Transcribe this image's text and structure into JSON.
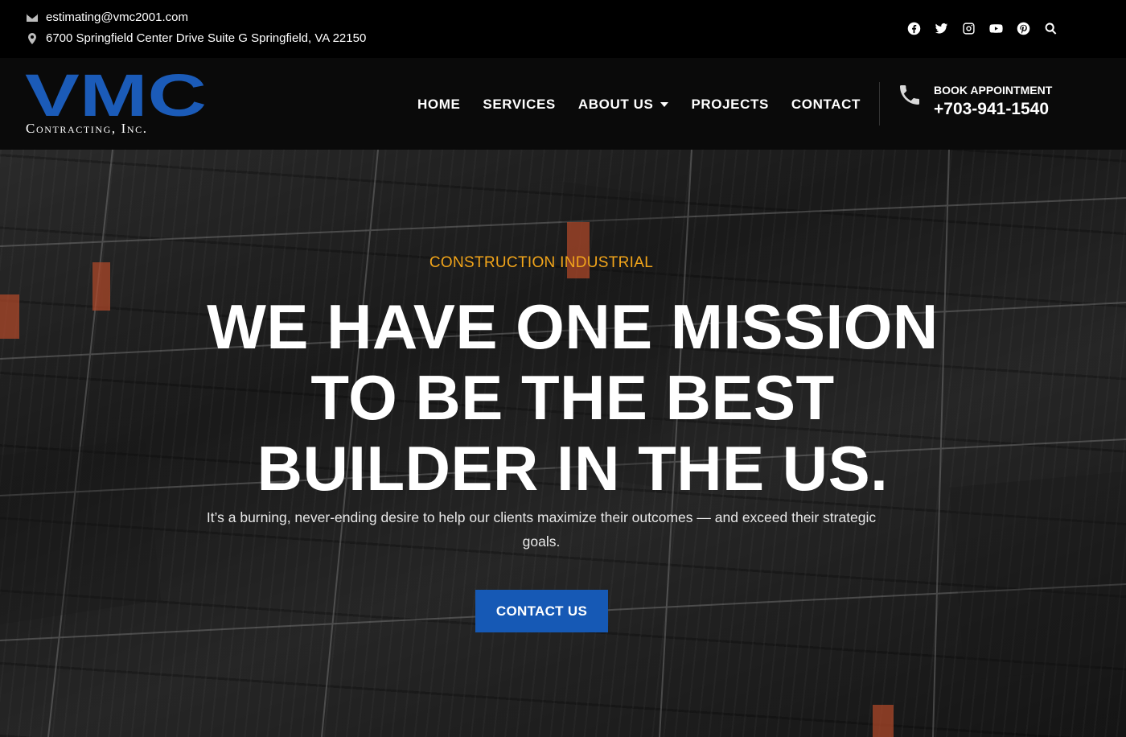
{
  "topbar": {
    "email": "estimating@vmc2001.com",
    "address": "6700 Springfield Center Drive Suite G Springfield, VA 22150",
    "email_icon": "envelope-icon",
    "address_icon": "map-pin-icon",
    "social_icons": [
      "facebook-icon",
      "twitter-icon",
      "instagram-icon",
      "youtube-icon",
      "pinterest-icon",
      "search-icon"
    ]
  },
  "logo": {
    "mark": "VMC",
    "subtitle": "Contracting, Inc.",
    "brand_color": "#1b5bb8"
  },
  "nav": {
    "items": [
      {
        "label": "HOME"
      },
      {
        "label": "SERVICES"
      },
      {
        "label": "ABOUT US",
        "has_dropdown": true
      },
      {
        "label": "PROJECTS"
      },
      {
        "label": "CONTACT"
      }
    ]
  },
  "appointment": {
    "label": "BOOK APPOINTMENT",
    "phone": "+703-941-1540",
    "icon": "phone-icon"
  },
  "hero": {
    "eyebrow": "CONSTRUCTION INDUSTRIAL",
    "headline_lines": [
      "WE HAVE ONE MISSION",
      "TO BE THE BEST",
      "BUILDER IN THE US."
    ],
    "subtext": "It’s a burning, never-ending desire to help our clients maximize their outcomes — and exceed their strategic goals.",
    "cta_label": "CONTACT US",
    "accent_color": "#f2a51a",
    "cta_color": "#1659b5"
  }
}
